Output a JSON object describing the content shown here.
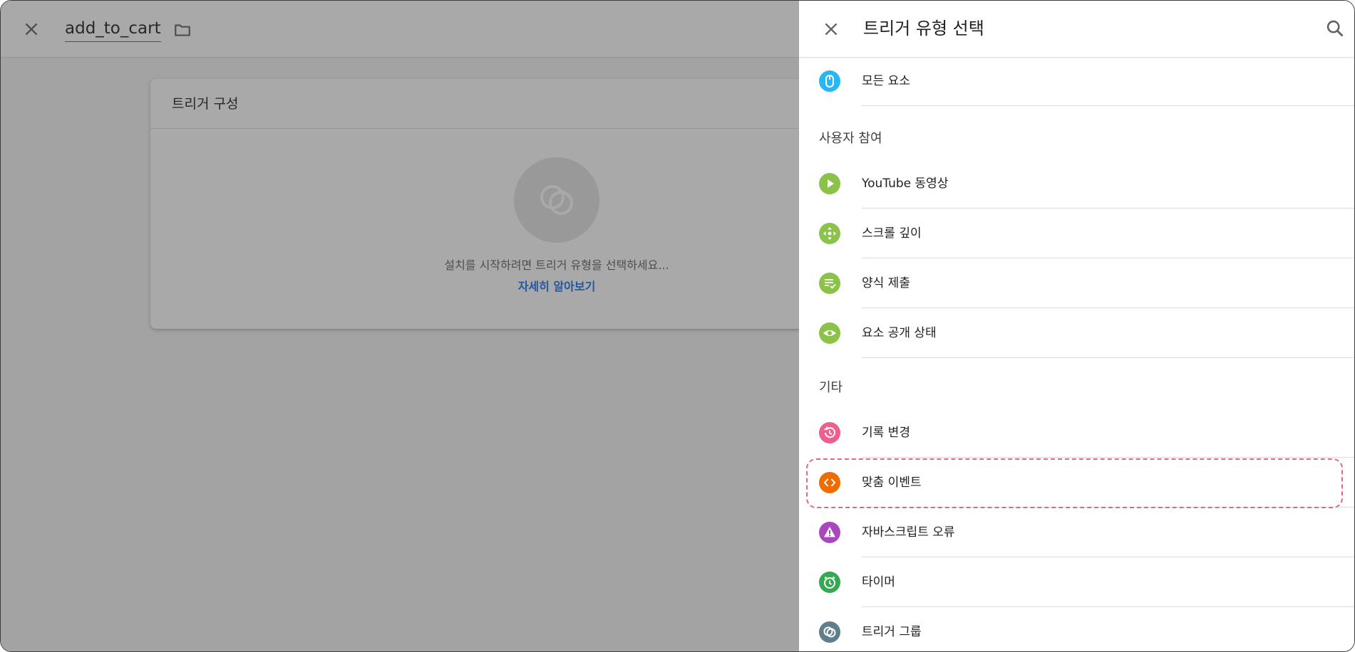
{
  "editor": {
    "tag_name": "add_to_cart",
    "card_title": "트리거 구성",
    "hint": "설치를 시작하려면 트리거 유형을 선택하세요...",
    "learn_more": "자세히 알아보기"
  },
  "panel": {
    "title": "트리거 유형 선택",
    "items": {
      "all_elements": "모든 요소",
      "youtube": "YouTube 동영상",
      "scroll_depth": "스크롤 깊이",
      "form_submit": "양식 제출",
      "element_visibility": "요소 공개 상태",
      "history_change": "기록 변경",
      "custom_event": "맞춤 이벤트",
      "javascript_error": "자바스크립트 오류",
      "timer": "타이머",
      "trigger_group": "트리거 그룹"
    },
    "sections": {
      "user_engagement": "사용자 참여",
      "other": "기타"
    }
  },
  "colors": {
    "blue": "#29b6f6",
    "green": "#8bc34a",
    "pink": "#ec5f8e",
    "orange": "#ef6c00",
    "purple": "#ab47bc",
    "dark_green": "#34a853",
    "slate": "#607d8b",
    "highlight": "#e0697c"
  }
}
